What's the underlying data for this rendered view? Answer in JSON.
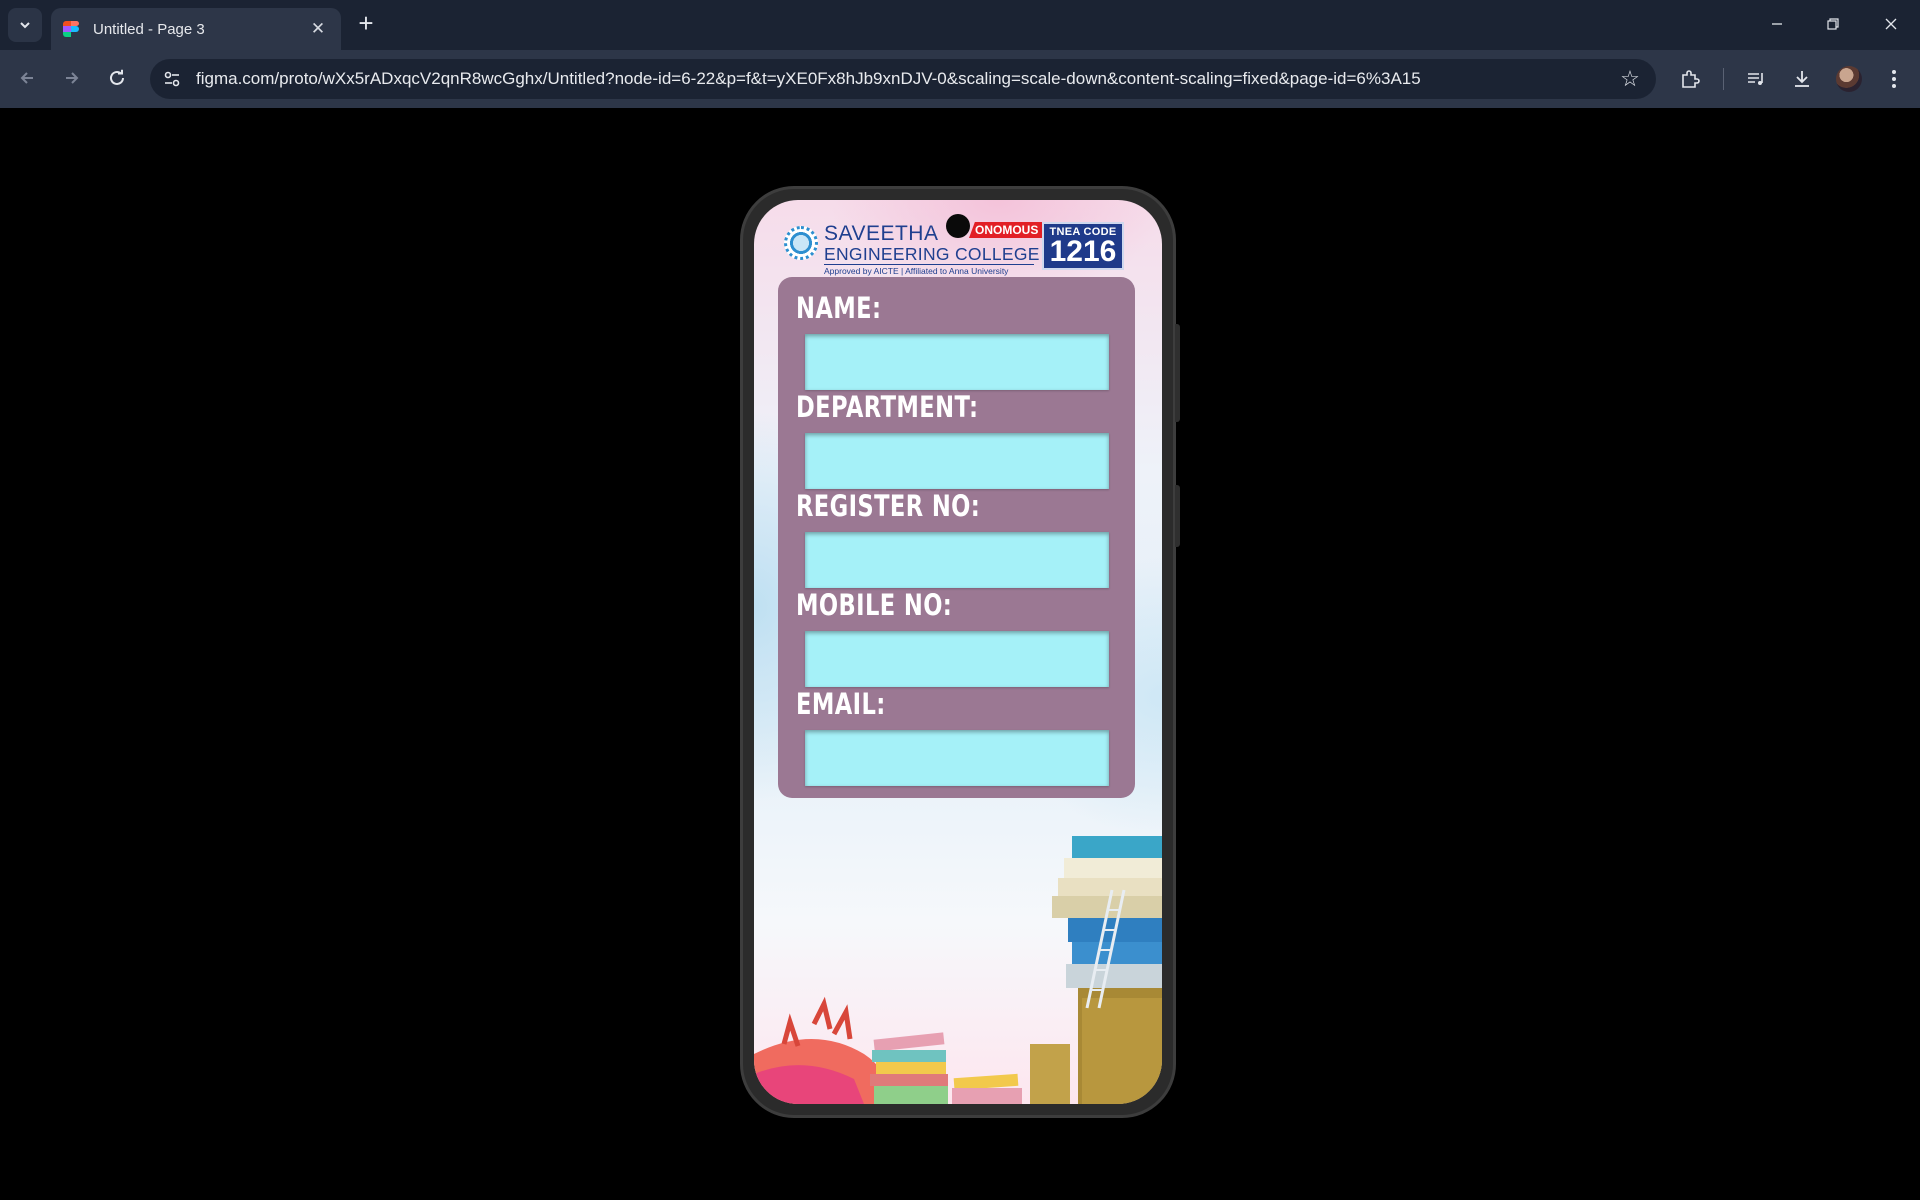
{
  "browser": {
    "tab_title": "Untitled - Page 3",
    "url": "figma.com/proto/wXx5rADxqcV2qnR8wcGghx/Untitled?node-id=6-22&p=f&t=yXE0Fx8hJb9xnDJV-0&scaling=scale-down&content-scaling=fixed&page-id=6%3A15",
    "icons": [
      "tab-list-icon",
      "figma-favicon",
      "close-icon",
      "plus-icon",
      "minimize-icon",
      "restore-icon",
      "close-window-icon",
      "back-arrow-icon",
      "forward-arrow-icon",
      "reload-icon",
      "site-info-icon",
      "star-icon",
      "extensions-icon",
      "media-control-icon",
      "download-icon",
      "profile-avatar",
      "kebab-menu-icon"
    ]
  },
  "header": {
    "college_name_line1": "SAVEETHA",
    "college_name_line2": "ENGINEERING COLLEGE",
    "affiliation": "Approved by AICTE  |  Affiliated to Anna University",
    "badge": "ONOMOUS",
    "tnea_label": "TNEA CODE",
    "tnea_code": "1216"
  },
  "form": {
    "name_label": "NAME:",
    "department_label": "DEPARTMENT:",
    "register_label": "REGISTER NO:",
    "mobile_label": "MOBILE NO:",
    "email_label": "EMAIL:",
    "name_value": "",
    "department_value": "",
    "register_value": "",
    "mobile_value": "",
    "email_value": ""
  },
  "colors": {
    "form_card": "#9b7893",
    "input_fill": "#a5f1f8",
    "header_blue": "#1f3a8a",
    "badge_red": "#e21f26",
    "browser_frame": "#1b2333"
  }
}
